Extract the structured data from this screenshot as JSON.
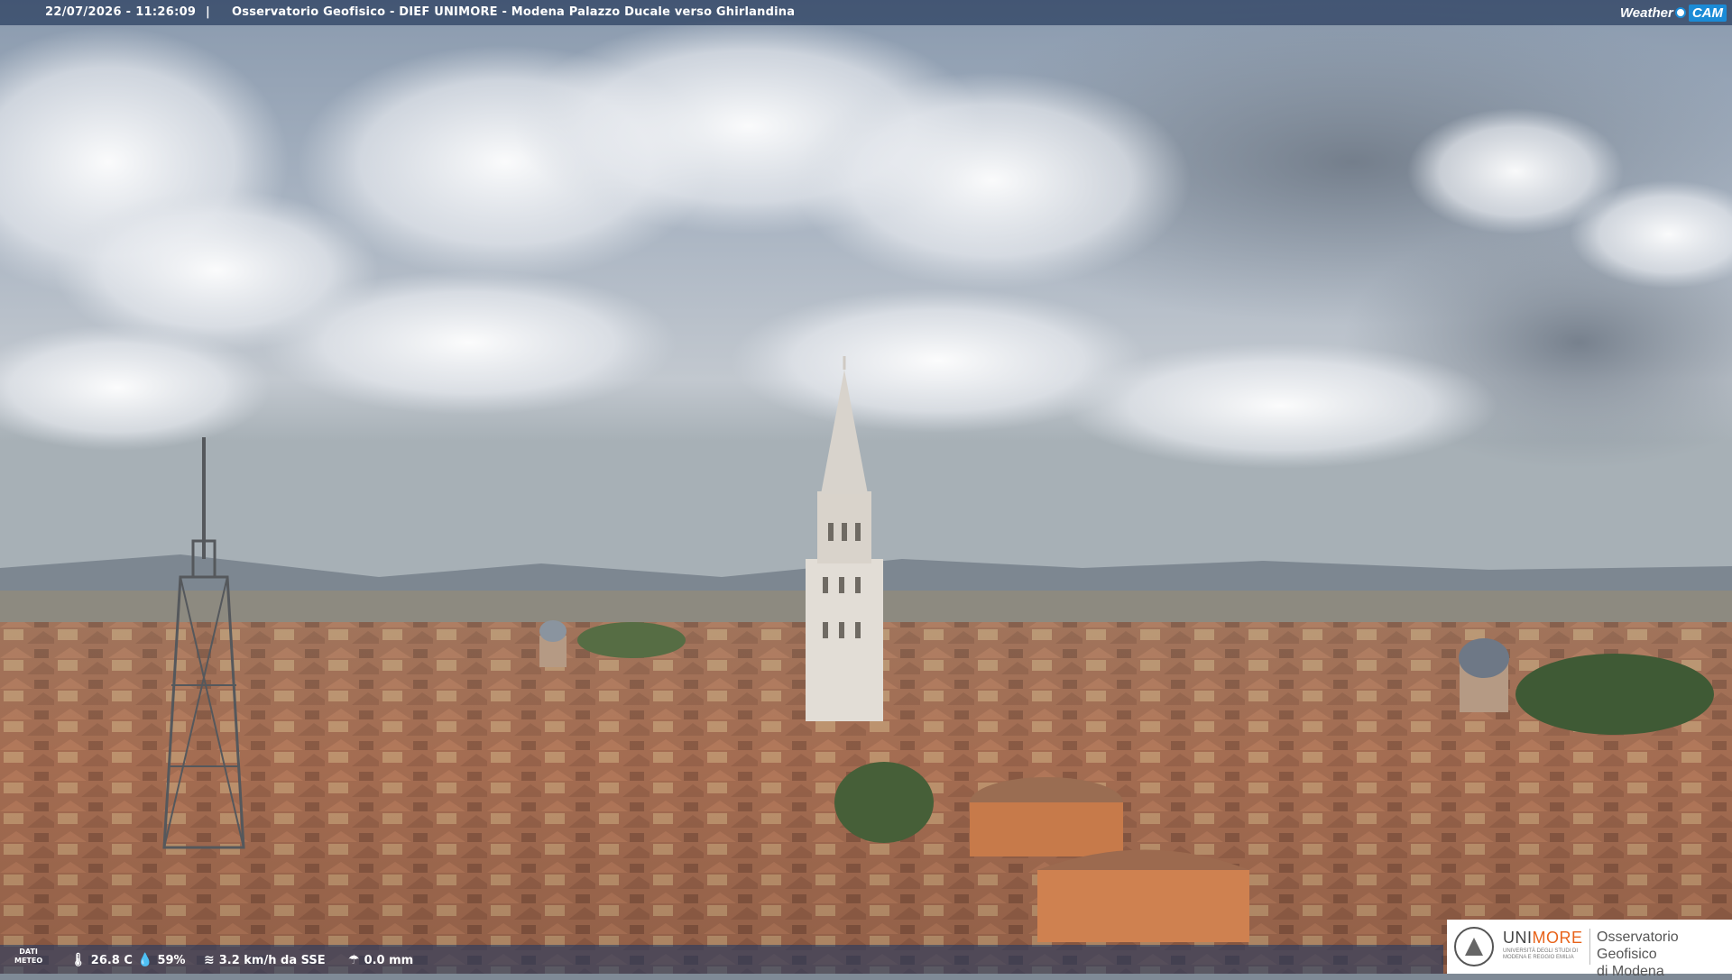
{
  "header": {
    "timestamp": "22/07/2026 - 11:26:09",
    "separator": "|",
    "location": "Osservatorio Geofisico - DIEF UNIMORE - Modena Palazzo Ducale verso Ghirlandina"
  },
  "brand": {
    "weather": "Weather",
    "cam": "CAM",
    "color": "#1b8bd6"
  },
  "weather": {
    "label_line1": "DATI",
    "label_line2": "METEO",
    "temperature": "26.8 C",
    "humidity": "59%",
    "wind": "3.2 km/h da SSE",
    "rain": "0.0 mm",
    "icons": [
      "thermometer-icon",
      "humidity-drop-icon",
      "wind-icon",
      "rain-icon"
    ]
  },
  "logo": {
    "uni": "UNI",
    "more": "MORE",
    "sub": "UNIVERSITÀ DEGLI STUDI DI MODENA E REGGIO EMILIA",
    "obs_line1": "Osservatorio Geofisico",
    "obs_line2": "di Modena",
    "accent": "#e8631a"
  }
}
